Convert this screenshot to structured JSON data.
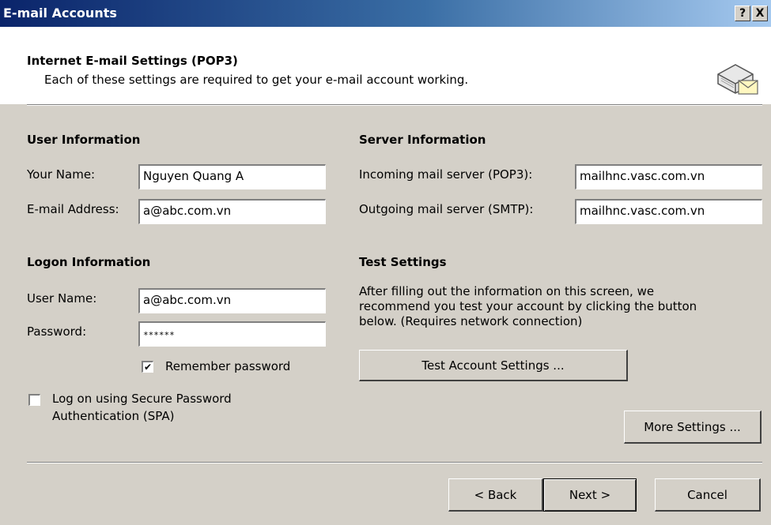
{
  "window": {
    "title": "E-mail Accounts",
    "help_btn": "?",
    "close_btn": "X"
  },
  "header": {
    "title": "Internet E-mail Settings (POP3)",
    "subtitle": "Each of these settings are required to get your e-mail account working.",
    "icon": "mail-server-icon"
  },
  "user_info": {
    "heading": "User Information",
    "name_label": "Your Name:",
    "name_value": "Nguyen Quang A",
    "email_label": "E-mail Address:",
    "email_value": "a@abc.com.vn"
  },
  "server_info": {
    "heading": "Server Information",
    "incoming_label": "Incoming mail server (POP3):",
    "incoming_value": "mailhnc.vasc.com.vn",
    "outgoing_label": "Outgoing mail server (SMTP):",
    "outgoing_value": "mailhnc.vasc.com.vn"
  },
  "logon_info": {
    "heading": "Logon Information",
    "user_label": "User Name:",
    "user_value": "a@abc.com.vn",
    "password_label": "Password:",
    "password_value": "******",
    "remember_label": "Remember password",
    "remember_checked": true,
    "spa_label_1": "Log on using Secure Password",
    "spa_label_2": "Authentication (SPA)",
    "spa_checked": false
  },
  "test_settings": {
    "heading": "Test Settings",
    "line1": "After filling out the information on this screen, we",
    "line2": "recommend you test your account by clicking the button",
    "line3": "below. (Requires network connection)",
    "test_button": "Test Account Settings ..."
  },
  "buttons": {
    "more_settings": "More Settings ...",
    "back": "< Back",
    "next": "Next >",
    "cancel": "Cancel"
  }
}
